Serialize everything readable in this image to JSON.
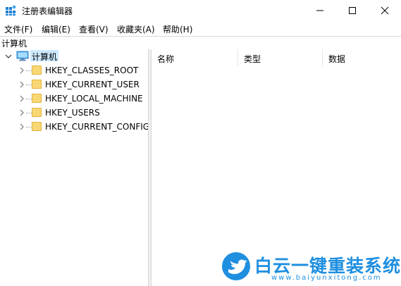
{
  "window": {
    "title": "注册表编辑器",
    "minimize_icon": "minimize-icon",
    "maximize_icon": "maximize-icon",
    "close_icon": "close-icon"
  },
  "menu": [
    "文件(F)",
    "编辑(E)",
    "查看(V)",
    "收藏夹(A)",
    "帮助(H)"
  ],
  "address": "计算机",
  "tree": {
    "root": {
      "label": "计算机",
      "icon": "computer-icon"
    },
    "children": [
      {
        "label": "HKEY_CLASSES_ROOT"
      },
      {
        "label": "HKEY_CURRENT_USER"
      },
      {
        "label": "HKEY_LOCAL_MACHINE"
      },
      {
        "label": "HKEY_USERS"
      },
      {
        "label": "HKEY_CURRENT_CONFIG"
      }
    ]
  },
  "columns": [
    "名称",
    "类型",
    "数据"
  ],
  "watermark": {
    "name": "白云一键重装系统",
    "url": "www.baiyunxitong.com"
  },
  "colors": {
    "accent": "#1f8fe0",
    "selection": "#cce8ff",
    "folder": "#f8d775"
  }
}
